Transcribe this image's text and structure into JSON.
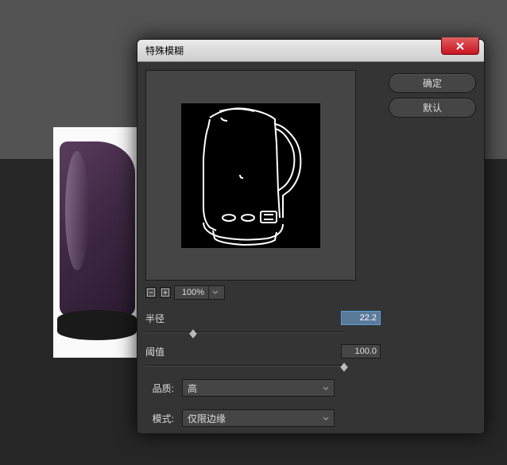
{
  "dialog": {
    "title": "特殊模糊",
    "buttons": {
      "ok": "确定",
      "default": "默认"
    },
    "zoom": {
      "value": "100%"
    },
    "radius": {
      "label": "半径",
      "value": "22.2",
      "pos": 22
    },
    "threshold": {
      "label": "阈值",
      "value": "100.0",
      "pos": 98
    },
    "quality": {
      "label": "品质:",
      "value": "高"
    },
    "mode": {
      "label": "模式:",
      "value": "仅限边缘"
    }
  }
}
